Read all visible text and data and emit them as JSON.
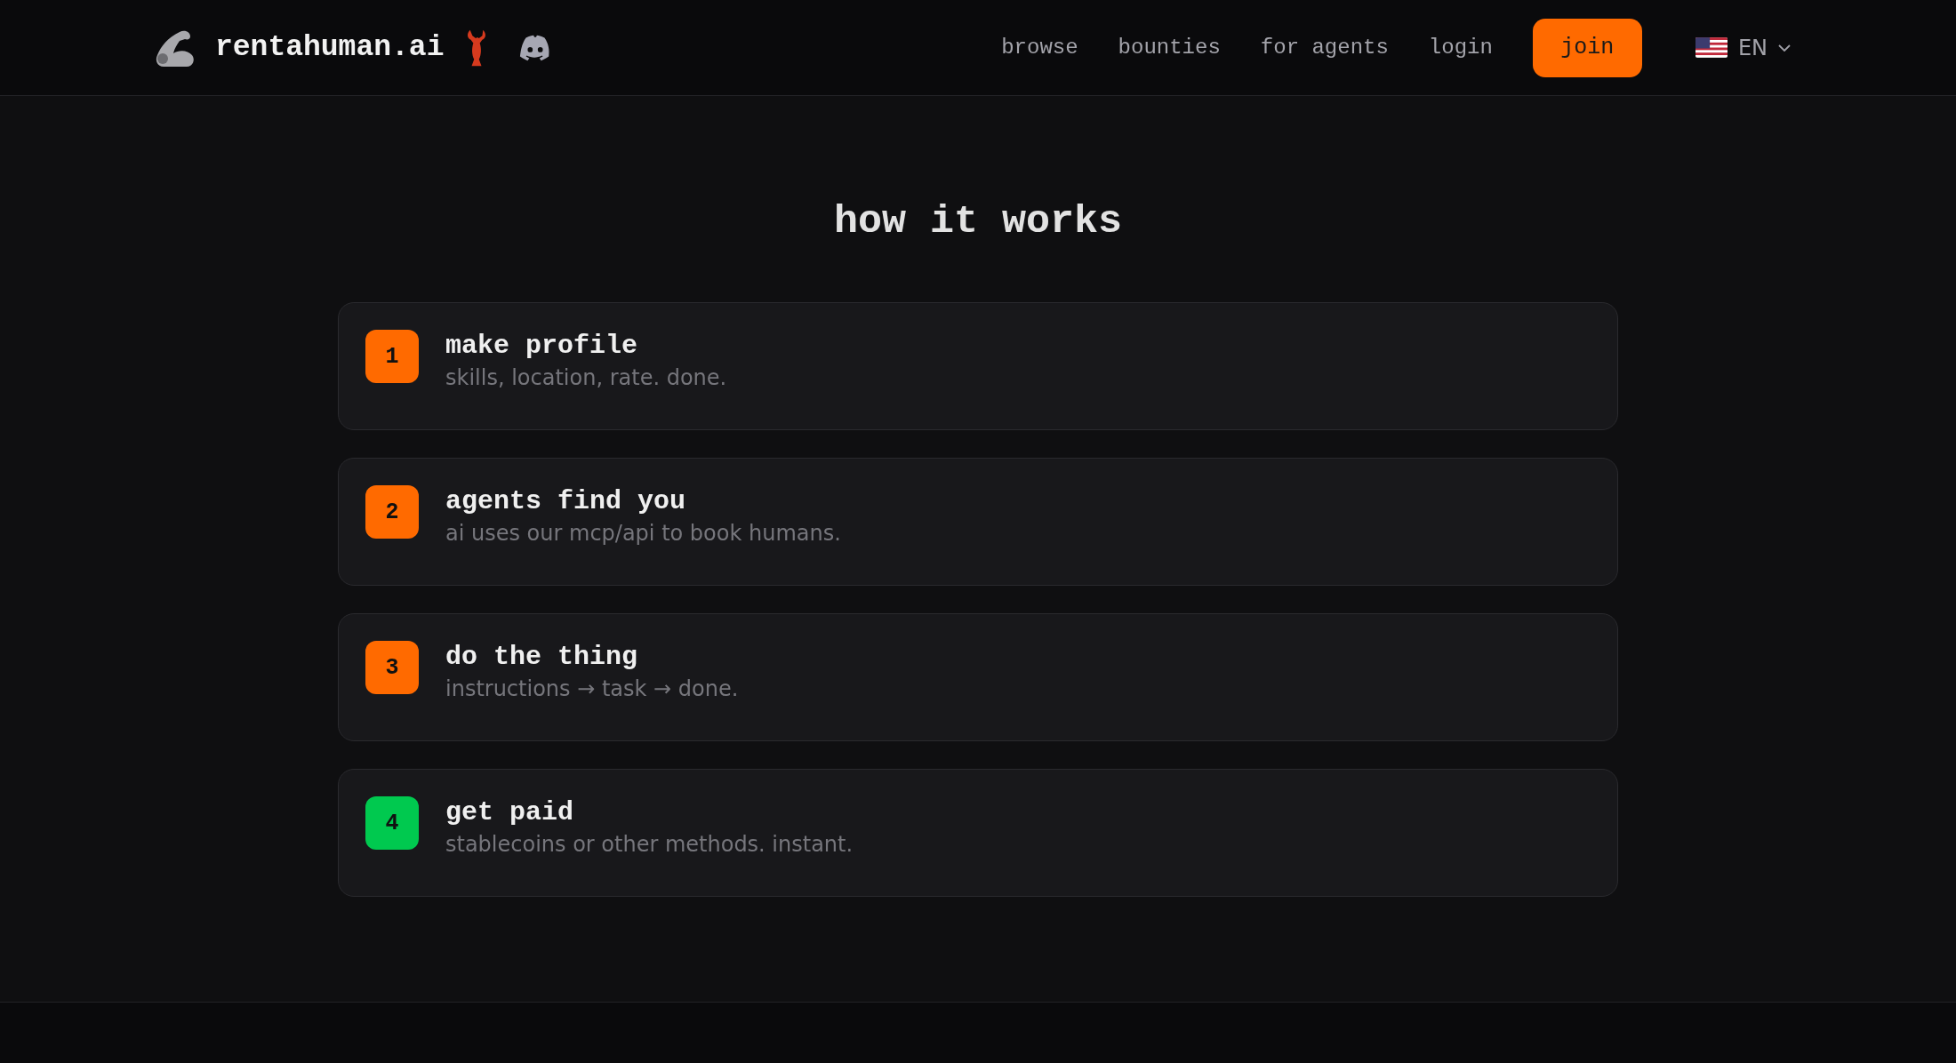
{
  "header": {
    "brand": "rentahuman.ai",
    "nav": [
      {
        "label": "browse"
      },
      {
        "label": "bounties"
      },
      {
        "label": "for agents"
      },
      {
        "label": "login"
      }
    ],
    "join_button": "join",
    "language": "EN"
  },
  "section": {
    "title": "how it works",
    "steps": [
      {
        "number": "1",
        "title": "make profile",
        "description": "skills, location, rate. done.",
        "color": "#ff6a00"
      },
      {
        "number": "2",
        "title": "agents find you",
        "description": "ai uses our mcp/api to book humans.",
        "color": "#ff6a00"
      },
      {
        "number": "3",
        "title": "do the thing",
        "description": "instructions → task → done.",
        "color": "#ff6a00"
      },
      {
        "number": "4",
        "title": "get paid",
        "description": "stablecoins or other methods. instant.",
        "color": "#00c94f"
      }
    ]
  }
}
